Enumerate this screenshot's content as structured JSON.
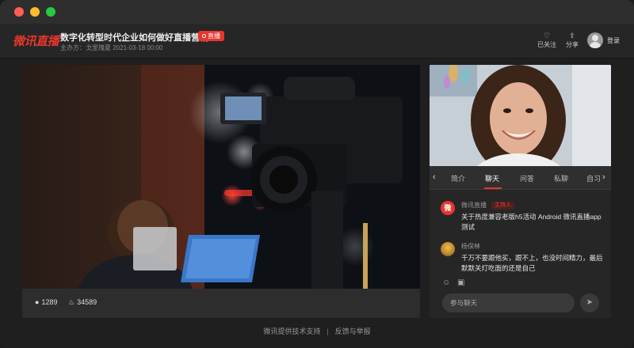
{
  "header": {
    "logo": "微讯直播",
    "title": "数字化转型时代企业如何做好直播营销",
    "live_badge": "直播",
    "organizer": "主办方：戈里瑰夏  2021-03-18 00:00",
    "follow_label": "已关注",
    "share_label": "分享",
    "login_label": "登录"
  },
  "player": {
    "viewers": "1289",
    "popularity": "34589"
  },
  "side": {
    "tabs": [
      "简介",
      "聊天",
      "问答",
      "私聊",
      "自习"
    ],
    "active_tab": "聊天",
    "messages": [
      {
        "name": "微讯直播",
        "badge": "主持人",
        "avatar_text": "微",
        "text": "关于热度兼容老版h5活动 Android 微讯直播app测试"
      },
      {
        "name": "杨保林",
        "badge": "",
        "text": "千万不要跟他买，跟不上，也没时间精力，最后默默关灯吃面的还是自己"
      }
    ],
    "chat_placeholder": "参与聊天"
  },
  "footer": {
    "support": "微讯提供技术支持",
    "feedback": "反馈与举报"
  },
  "colors": {
    "accent": "#e8362d",
    "background": "#1f1f1f",
    "panel": "#262626"
  },
  "icons": [
    "heart-icon",
    "share-icon",
    "user-icon",
    "flame-icon",
    "emoji-icon",
    "image-icon",
    "send-icon",
    "chevron-left-icon",
    "chevron-right-icon"
  ]
}
